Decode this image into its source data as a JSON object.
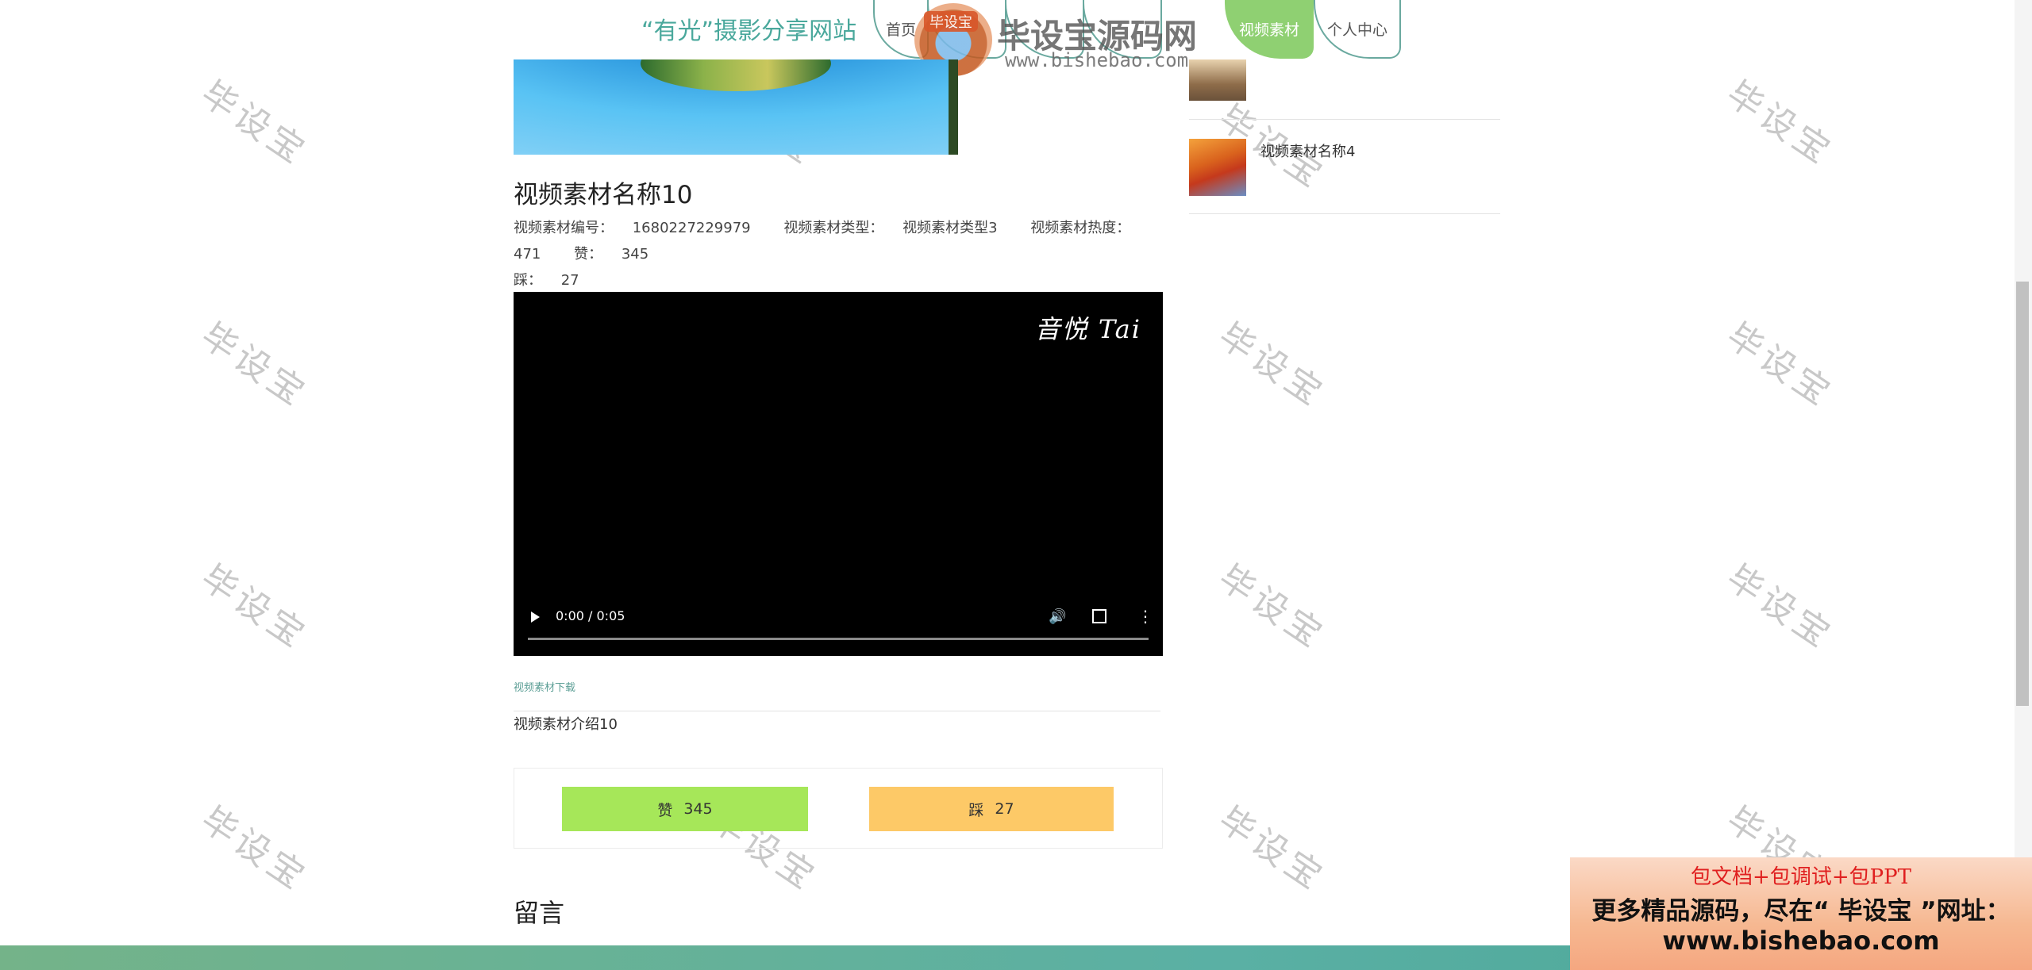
{
  "header": {
    "site_title": "“有光”摄影分享网站",
    "nav": [
      {
        "label": "首页",
        "active": false
      },
      {
        "label": "",
        "active": false
      },
      {
        "label": "",
        "active": false
      },
      {
        "label": "",
        "active": false
      },
      {
        "label": "视频素材",
        "active": true
      },
      {
        "label": "个人中心",
        "active": false
      }
    ],
    "overlay_logo": {
      "badge": "毕设宝",
      "name": "毕设宝源码网",
      "url": "www.bishebao.com"
    }
  },
  "main": {
    "title": "视频素材名称10",
    "meta": [
      {
        "label": "视频素材编号：",
        "value": "1680227229979"
      },
      {
        "label": "视频素材类型：",
        "value": "视频素材类型3"
      },
      {
        "label": "视频素材热度：",
        "value": "471"
      },
      {
        "label": "赞：",
        "value": "345"
      },
      {
        "label": "踩：",
        "value": "27"
      }
    ],
    "video": {
      "watermark": "音悦 Tai",
      "time": "0:00 / 0:05",
      "progress": 0
    },
    "download_link": "视频素材下载",
    "intro": "视频素材介绍10",
    "like_button": {
      "label": "赞",
      "count": "345"
    },
    "dislike_button": {
      "label": "踩",
      "count": "27"
    },
    "comments_title": "留言"
  },
  "sidebar": {
    "items": [
      {
        "label": ""
      },
      {
        "label": "视频素材名称4"
      }
    ]
  },
  "ad": {
    "line1": "包文档+包调试+包PPT",
    "line2": "更多精品源码，尽在“ 毕设宝 ”网址：",
    "line3": "www.bishebao.com"
  },
  "watermark_text": "毕设宝",
  "colors": {
    "accent": "#4aa89c",
    "active_tab": "#8fd072",
    "like": "#a6e759",
    "dislike": "#fdc967",
    "footer": "#5ab0a4"
  }
}
